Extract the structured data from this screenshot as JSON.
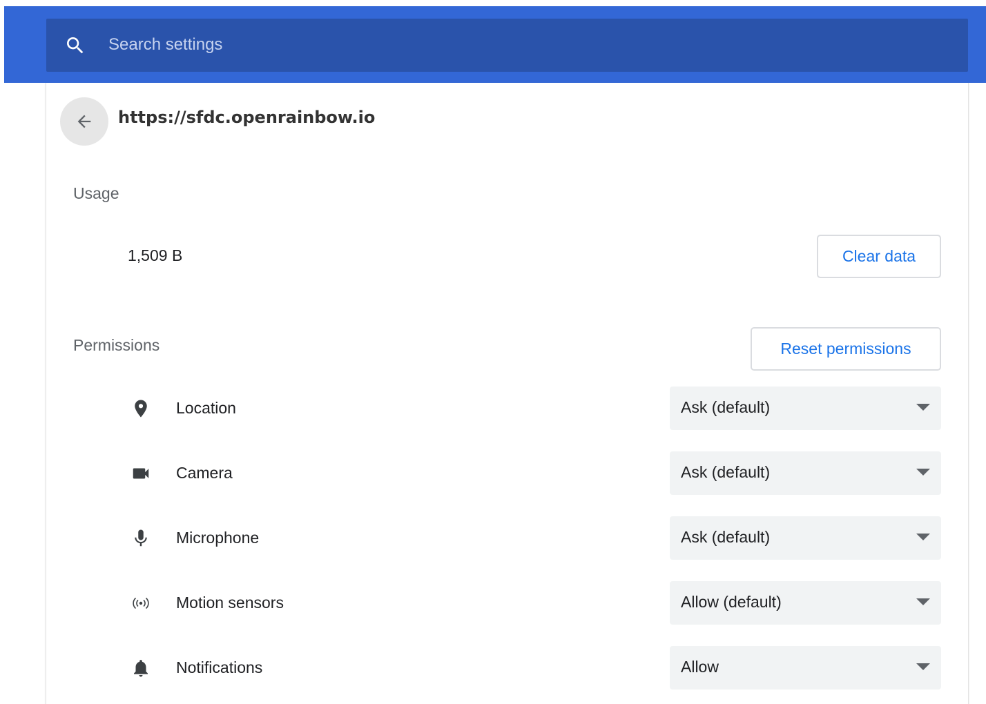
{
  "search": {
    "placeholder": "Search settings"
  },
  "site": {
    "url": "https://sfdc.openrainbow.io"
  },
  "usage": {
    "label": "Usage",
    "value": "1,509 B",
    "clear_button": "Clear data"
  },
  "permissions": {
    "label": "Permissions",
    "reset_button": "Reset permissions",
    "items": [
      {
        "icon": "location-pin-icon",
        "label": "Location",
        "value": "Ask (default)"
      },
      {
        "icon": "camera-icon",
        "label": "Camera",
        "value": "Ask (default)"
      },
      {
        "icon": "microphone-icon",
        "label": "Microphone",
        "value": "Ask (default)"
      },
      {
        "icon": "motion-sensors-icon",
        "label": "Motion sensors",
        "value": "Allow (default)"
      },
      {
        "icon": "bell-icon",
        "label": "Notifications",
        "value": "Allow"
      }
    ]
  },
  "colors": {
    "header": "#3367d6",
    "search_box": "#2a53ab",
    "accent": "#1a73e8"
  }
}
